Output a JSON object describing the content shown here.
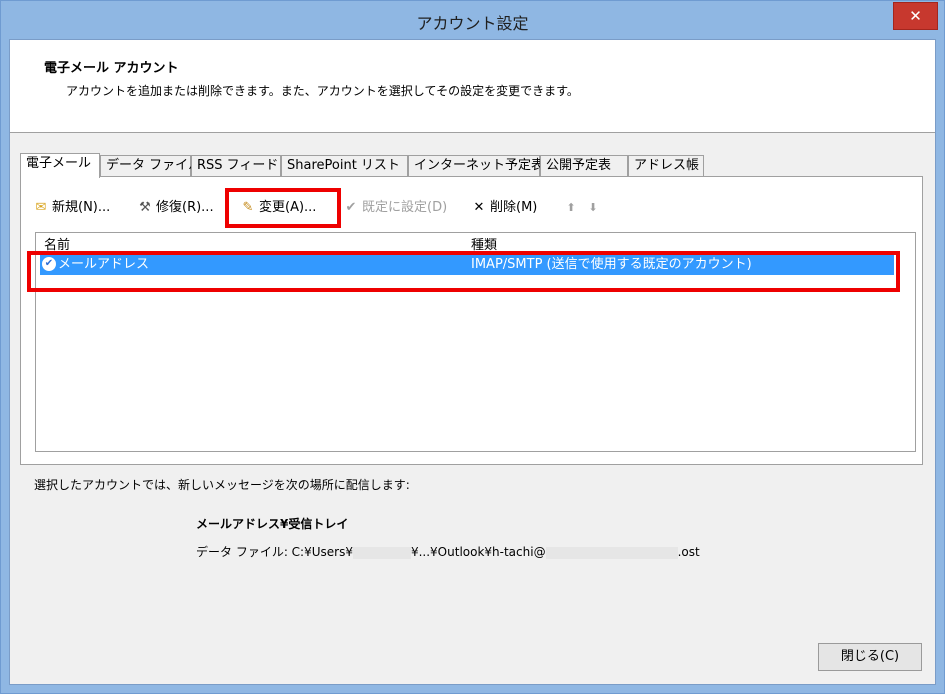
{
  "window": {
    "title": "アカウント設定",
    "close_glyph": "✕"
  },
  "header": {
    "title": "電子メール アカウント",
    "description": "アカウントを追加または削除できます。また、アカウントを選択してその設定を変更できます。"
  },
  "tabs": [
    {
      "label": "電子メール"
    },
    {
      "label": "データ ファイル"
    },
    {
      "label": "RSS フィード"
    },
    {
      "label": "SharePoint リスト"
    },
    {
      "label": "インターネット予定表"
    },
    {
      "label": "公開予定表"
    },
    {
      "label": "アドレス帳"
    }
  ],
  "toolbar": {
    "new_label": "新規(N)...",
    "repair_label": "修復(R)...",
    "change_label": "変更(A)...",
    "set_default_label": "既定に設定(D)",
    "delete_label": "削除(M)",
    "up_glyph": "⬆",
    "down_glyph": "⬇"
  },
  "list": {
    "headers": {
      "name": "名前",
      "type": "種類"
    },
    "rows": [
      {
        "name": "メールアドレス",
        "type": "IMAP/SMTP (送信で使用する既定のアカウント)"
      }
    ]
  },
  "info": {
    "text": "選択したアカウントでは、新しいメッセージを次の場所に配信します:",
    "folder": "メールアドレス¥受信トレイ",
    "datafile_prefix": "データ ファイル: C:¥Users¥",
    "datafile_mid": "¥...¥Outlook¥h-tachi@",
    "datafile_suffix": ".ost"
  },
  "footer": {
    "close_label": "閉じる(C)"
  },
  "colors": {
    "highlight": "#ee0000",
    "selection": "#3399ff",
    "title_bar": "#8fb7e3"
  }
}
